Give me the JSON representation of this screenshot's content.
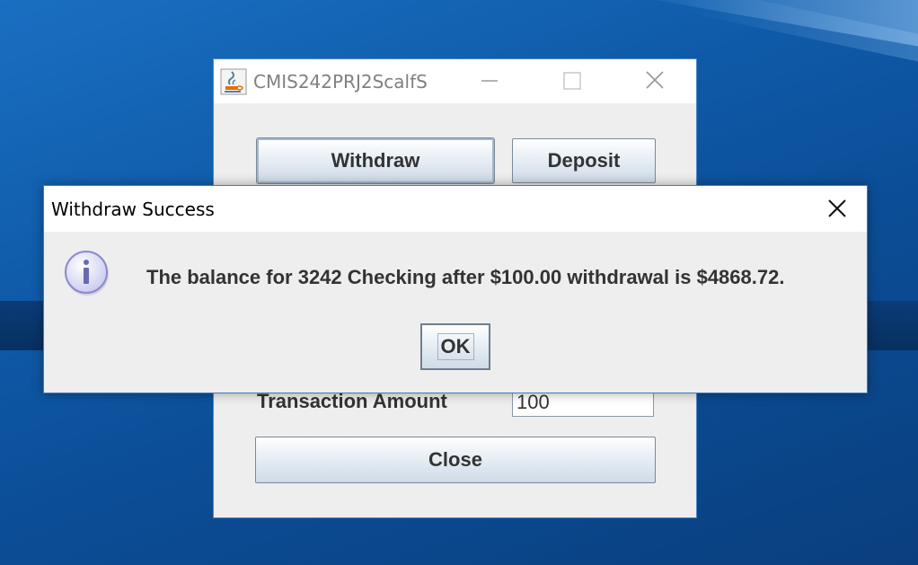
{
  "app_window": {
    "title": "CMIS242PRJ2ScalfS",
    "withdraw_label": "Withdraw",
    "deposit_label": "Deposit",
    "transaction_amount_label": "Transaction Amount",
    "transaction_amount_value": "100",
    "close_label": "Close"
  },
  "dialog": {
    "title": "Withdraw Success",
    "message": "The balance for 3242 Checking after $100.00 withdrawal is $4868.72.",
    "ok_label": "OK",
    "icon": "info-icon"
  },
  "colors": {
    "desktop_blue": "#0f5aa8",
    "window_border": "#4f88c8",
    "panel_bg": "#eeeeee",
    "info_icon_fill": "#c8c8f0",
    "info_icon_stroke": "#8a8ad0"
  }
}
